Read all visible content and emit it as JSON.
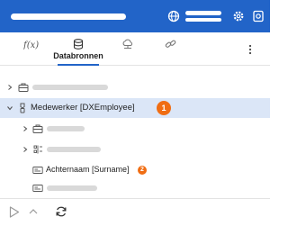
{
  "header": {
    "background": "#2264c8",
    "icons": [
      "globe-icon",
      "gear-icon",
      "exit-icon"
    ]
  },
  "tabs": [
    {
      "label": "",
      "icon": "function-icon",
      "active": false
    },
    {
      "label": "Databronnen",
      "icon": "database-icon",
      "active": true
    },
    {
      "label": "",
      "icon": "cloud-network-icon",
      "active": false
    },
    {
      "label": "",
      "icon": "link-icon",
      "active": false
    }
  ],
  "tree": {
    "items": [
      {
        "label": "",
        "icon": "briefcase-icon",
        "expanded": false,
        "level": 0
      },
      {
        "label": "Medewerker [DXEmployee]",
        "icon": "entity-icon",
        "expanded": true,
        "level": 0,
        "selected": true,
        "badge": "1"
      },
      {
        "label": "",
        "icon": "briefcase-icon",
        "expanded": false,
        "level": 1
      },
      {
        "label": "",
        "icon": "attribute-list-icon",
        "expanded": false,
        "level": 1
      },
      {
        "label": "Achternaam [Surname]",
        "icon": "text-field-icon",
        "level": 1,
        "badge": "2"
      },
      {
        "label": "",
        "icon": "text-field-icon",
        "level": 1
      }
    ]
  },
  "footer": {
    "icons": [
      "play-icon",
      "chevron-up-icon",
      "refresh-icon"
    ]
  },
  "colors": {
    "accent": "#2264c8",
    "selected_row": "#dbe6f7",
    "badge": "#f06d13"
  }
}
